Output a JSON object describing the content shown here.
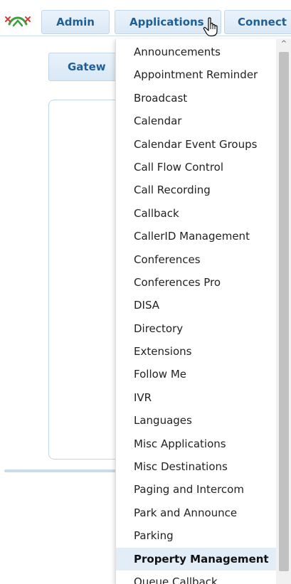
{
  "nav": {
    "admin_label": "Admin",
    "applications_label": "Applications",
    "connectivity_label": "Connect"
  },
  "background": {
    "gateway_tab_label": "Gatew"
  },
  "dropdown": {
    "items": [
      {
        "label": "Announcements"
      },
      {
        "label": "Appointment Reminder"
      },
      {
        "label": "Broadcast"
      },
      {
        "label": "Calendar"
      },
      {
        "label": "Calendar Event Groups"
      },
      {
        "label": "Call Flow Control"
      },
      {
        "label": "Call Recording"
      },
      {
        "label": "Callback"
      },
      {
        "label": "CallerID Management"
      },
      {
        "label": "Conferences"
      },
      {
        "label": "Conferences Pro"
      },
      {
        "label": "DISA"
      },
      {
        "label": "Directory"
      },
      {
        "label": "Extensions"
      },
      {
        "label": "Follow Me"
      },
      {
        "label": "IVR"
      },
      {
        "label": "Languages"
      },
      {
        "label": "Misc Applications"
      },
      {
        "label": "Misc Destinations"
      },
      {
        "label": "Paging and Intercom"
      },
      {
        "label": "Park and Announce"
      },
      {
        "label": "Parking"
      },
      {
        "label": "Property Management"
      },
      {
        "label": "Queue Callback"
      }
    ],
    "highlighted_item": "Property Management",
    "scroll_up_glyph": "^"
  },
  "colors": {
    "nav_text": "#1f5f96",
    "nav_button_bg": "#dbe9f6",
    "highlight_bg": "#e3edf8",
    "logo_green": "#3f9f3f",
    "logo_red": "#d83a3a"
  },
  "icons": {
    "logo": "freepbx-logo",
    "cursor": "hand-pointer-icon",
    "scroll_up": "scroll-up-arrow-icon"
  }
}
